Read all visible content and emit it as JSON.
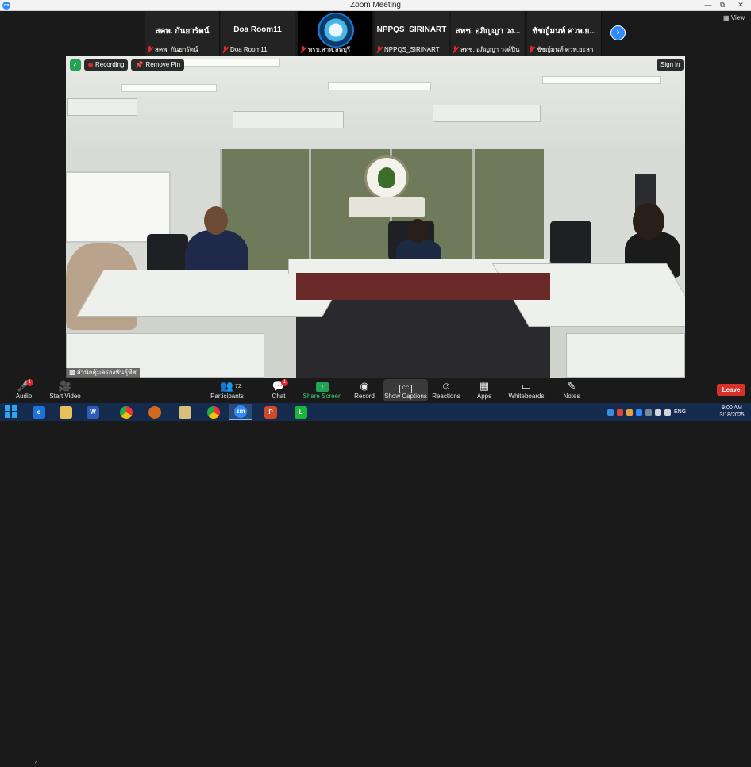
{
  "window": {
    "title": "Zoom Meeting",
    "app_icon": "zm"
  },
  "gallery": {
    "tiles": [
      {
        "name": "สคพ. กันยารัตน์",
        "footer": "สคพ. กันยารัตน์"
      },
      {
        "name": "Doa Room11",
        "footer": "Doa Room11"
      },
      {
        "name": "",
        "footer": "พรบ.สาพ.ลพบุรี"
      },
      {
        "name": "NPPQS_SIRINART",
        "footer": "NPPQS_SIRINART"
      },
      {
        "name": "สทช. อภิญญา วง...",
        "footer": "สทช. อภิญญา วงศ์ปิ่น"
      },
      {
        "name": "ชัชญ์มนท์ ศวพ.ย...",
        "footer": "ชัชญ์มนท์ ศวพ.ยะลา"
      }
    ],
    "next_icon": "chevron-right-icon",
    "view_label": "View"
  },
  "video": {
    "recording_label": "Recording",
    "remove_pin_label": "Remove Pin",
    "sign_in_label": "Sign in",
    "caption": "สำนักคุ้มครองพันธุ์พืช"
  },
  "toolbar": {
    "audio": {
      "label": "Audio",
      "badge": "1"
    },
    "video": {
      "label": "Start Video"
    },
    "participants": {
      "label": "Participants",
      "count": "72"
    },
    "chat": {
      "label": "Chat",
      "badge": "1"
    },
    "share": {
      "label": "Share Screen"
    },
    "record": {
      "label": "Record"
    },
    "captions": {
      "label": "Show Captions",
      "icon_text": "CC"
    },
    "reactions": {
      "label": "Reactions"
    },
    "apps": {
      "label": "Apps"
    },
    "whiteboards": {
      "label": "Whiteboards"
    },
    "notes": {
      "label": "Notes"
    },
    "leave": {
      "label": "Leave"
    }
  },
  "taskbar": {
    "apps": [
      "edge",
      "file-explorer",
      "word",
      "chrome",
      "chrome-profile",
      "folder",
      "chrome-2",
      "zoom",
      "powerpoint",
      "line"
    ],
    "tray": {
      "language": "ENG"
    },
    "clock": {
      "time": "9:00 AM",
      "date": "3/18/2025"
    }
  },
  "colors": {
    "zoom_blue": "#2d8cff",
    "leave_red": "#d8322a",
    "share_green": "#23a455",
    "taskbar": "#142b4e"
  }
}
